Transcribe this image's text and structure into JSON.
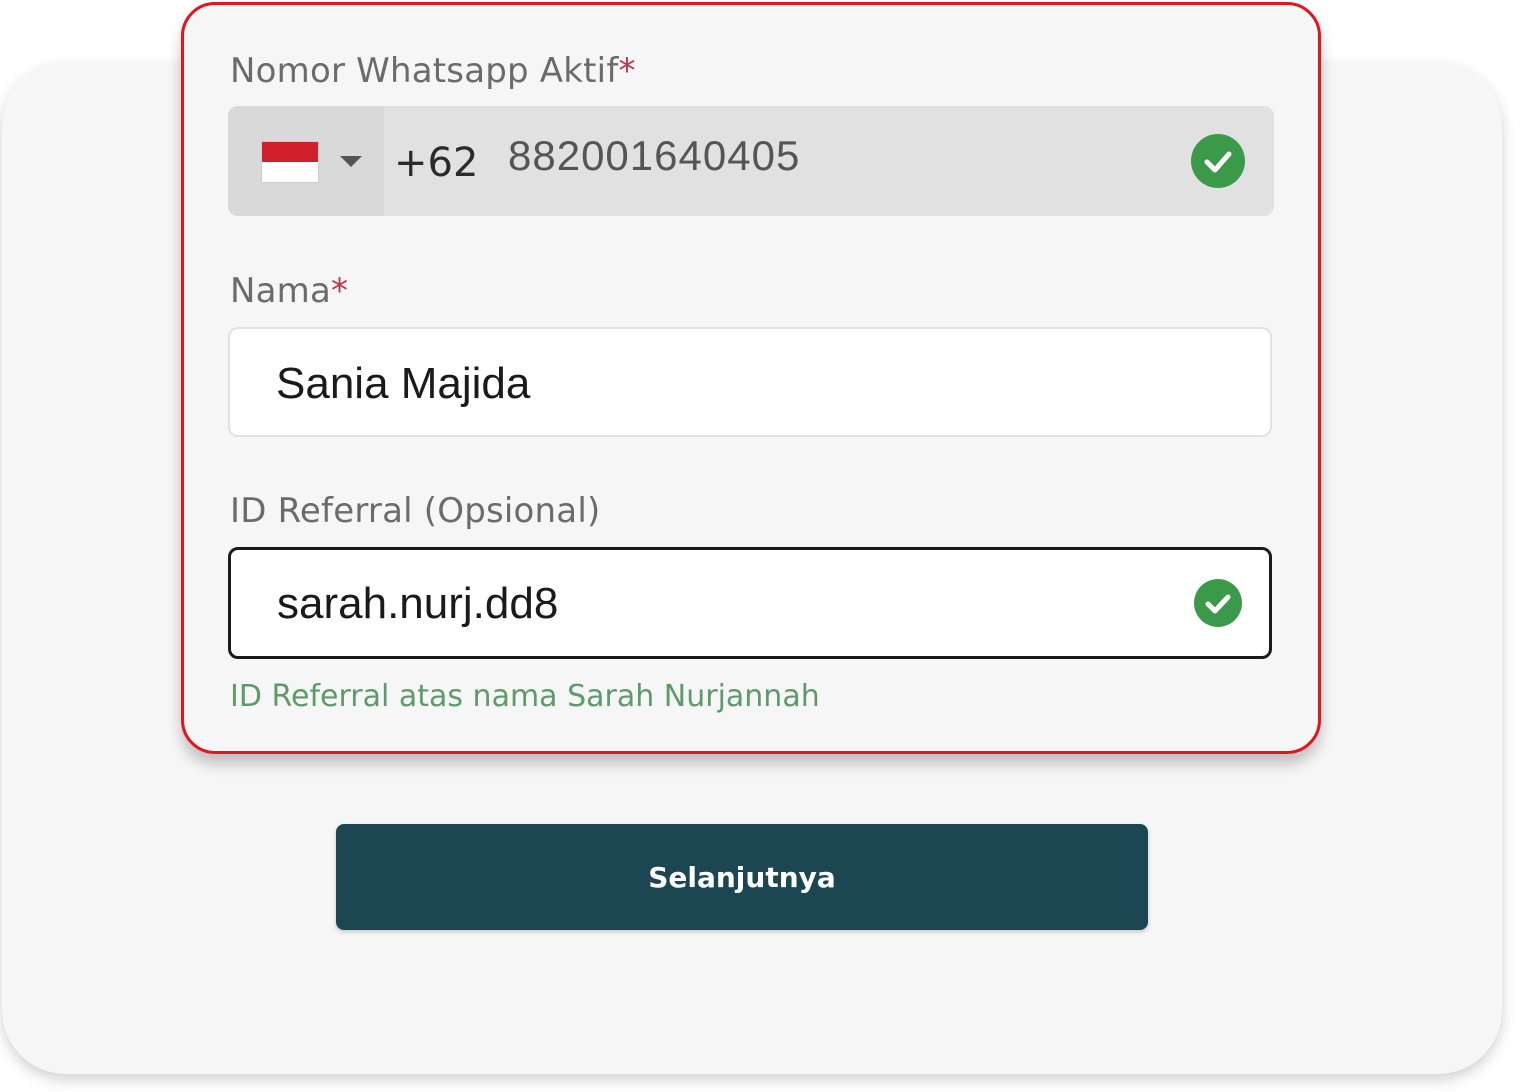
{
  "form": {
    "phone": {
      "label": "Nomor Whatsapp Aktif",
      "required_mark": "*",
      "country_flag": "indonesia-flag",
      "dial_code": "+62",
      "value": "882001640405",
      "status_icon": "check-circle-icon"
    },
    "name": {
      "label": "Nama",
      "required_mark": "*",
      "value": "Sania Majida"
    },
    "referral": {
      "label": "ID Referral (Opsional)",
      "value": "sarah.nurj.dd8",
      "status_icon": "check-circle-icon",
      "helper_text": "ID Referral atas nama Sarah Nurjannah"
    }
  },
  "actions": {
    "next_label": "Selanjutnya"
  },
  "colors": {
    "highlight_border": "#e3141a",
    "success": "#3a9a4a",
    "primary_button": "#1c4752",
    "required_mark": "#c0334a",
    "helper_text": "#5f9b6a"
  }
}
